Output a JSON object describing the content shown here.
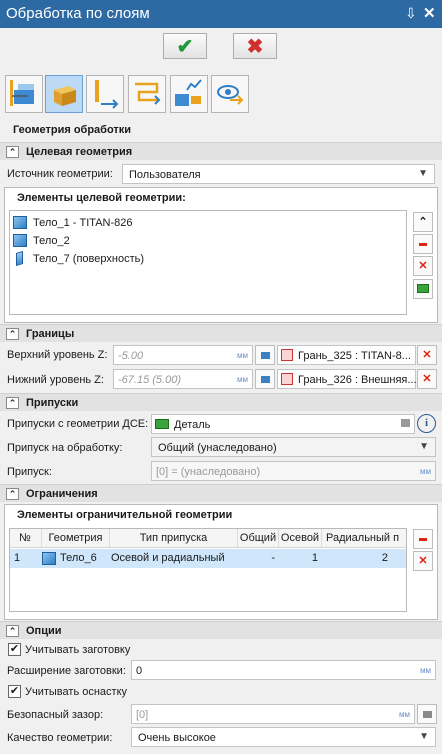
{
  "window": {
    "title": "Обработка по слоям",
    "pin_glyph": "⇩",
    "close_glyph": "✕"
  },
  "actions": {
    "ok_glyph": "✔",
    "cancel_glyph": "✖"
  },
  "toolbar": {
    "icons": [
      "layers-tool-icon",
      "body-tool-icon",
      "depth-tool-icon",
      "path-tool-icon",
      "link-tool-icon",
      "view-tool-icon"
    ]
  },
  "sections": {
    "geometry_header": "Геометрия обработки",
    "target_geometry": "Целевая геометрия",
    "boundaries": "Границы",
    "allowances": "Припуски",
    "restrictions": "Ограничения",
    "options": "Опции"
  },
  "target": {
    "source_label": "Источник геометрии:",
    "source_value": "Пользователя",
    "elements_label": "Элементы целевой геометрии:",
    "items": [
      "Тело_1 - TITAN-826",
      "Тело_2",
      "Тело_7 (поверхность)"
    ]
  },
  "bounds": {
    "upper_label": "Верхний уровень Z:",
    "upper_value": "-5.00",
    "upper_unit": "мм",
    "upper_face": "Грань_325 : TITAN-8...",
    "lower_label": "Нижний уровень Z:",
    "lower_value": "-67.15 (5.00)",
    "lower_unit": "мм",
    "lower_face": "Грань_326 : Внешняя..."
  },
  "allow": {
    "from_dse_label": "Припуски с геометрии ДСЕ:",
    "from_dse_value": "Деталь",
    "machining_label": "Припуск на обработку:",
    "machining_value": "Общий (унаследовано)",
    "allowance_label": "Припуск:",
    "allowance_value": "[0] = (унаследовано)",
    "allowance_unit": "мм"
  },
  "restr": {
    "elements_label": "Элементы ограничительной геометрии",
    "columns": [
      "№",
      "Геометрия",
      "Тип припуска",
      "Общий",
      "Осевой",
      "Радиальный п"
    ],
    "rows": [
      {
        "num": "1",
        "geometry": "Тело_6",
        "type": "Осевой и радиальный",
        "common": "-",
        "axial": "1",
        "radial": "2"
      }
    ]
  },
  "opts": {
    "use_blank_label": "Учитывать заготовку",
    "use_blank_checked": true,
    "blank_ext_label": "Расширение заготовки:",
    "blank_ext_value": "0",
    "blank_ext_unit": "мм",
    "use_fixture_label": "Учитывать оснастку",
    "use_fixture_checked": true,
    "safe_gap_label": "Безопасный зазор:",
    "safe_gap_value": "[0]",
    "safe_gap_unit": "мм",
    "quality_label": "Качество геометрии:",
    "quality_value": "Очень высокое"
  },
  "colors": {
    "title_bar": "#2d6aa3",
    "ok_green": "#1f9a3a",
    "cancel_red": "#d0312d",
    "selection": "#cfe6fb"
  }
}
